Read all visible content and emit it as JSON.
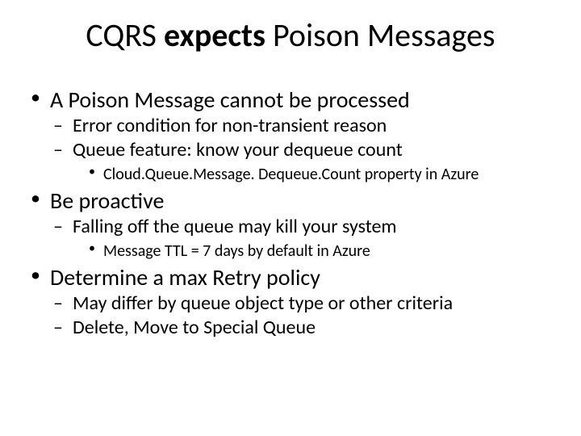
{
  "title": {
    "part1": "CQRS ",
    "part2": "expects",
    "part3": " Poison Messages"
  },
  "bullets": [
    {
      "text": "A Poison Message cannot be processed",
      "sub": [
        {
          "text": "Error condition for non-transient reason",
          "sub": []
        },
        {
          "text": "Queue feature: know your dequeue count",
          "sub": [
            {
              "text": "Cloud.Queue.Message. Dequeue.Count property in Azure"
            }
          ]
        }
      ]
    },
    {
      "text": "Be proactive",
      "sub": [
        {
          "text": "Falling off the queue may kill your system",
          "sub": [
            {
              "text": "Message TTL = 7 days by default in Azure"
            }
          ]
        }
      ]
    },
    {
      "text": "Determine a max Retry policy",
      "sub": [
        {
          "text": "May differ by queue object type or other criteria",
          "sub": []
        },
        {
          "text": "Delete, Move to Special Queue",
          "sub": []
        }
      ]
    }
  ]
}
